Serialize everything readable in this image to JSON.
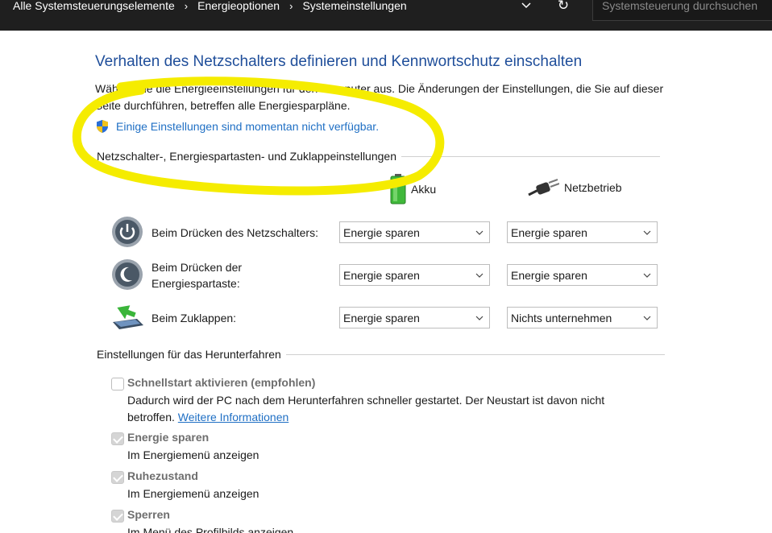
{
  "breadcrumb": {
    "items": [
      "Alle Systemsteuerungselemente",
      "Energieoptionen",
      "Systemeinstellungen"
    ]
  },
  "search": {
    "placeholder": "Systemsteuerung durchsuchen"
  },
  "page": {
    "title": "Verhalten des Netzschalters definieren und Kennwortschutz einschalten",
    "intro": "Wählen Sie die Energieeinstellungen für den Computer aus. Die Änderungen der Einstellungen, die Sie auf dieser Seite durchführen, betreffen alle Energiesparpläne.",
    "unavailable_link": "Einige Einstellungen sind momentan nicht verfügbar."
  },
  "buttons_section": {
    "heading": "Netzschalter-, Energiespartasten- und Zuklappeinstellungen",
    "col_battery": "Akku",
    "col_power": "Netzbetrieb",
    "rows": [
      {
        "label": "Beim Drücken des Netzschalters:",
        "battery": "Energie sparen",
        "power": "Energie sparen"
      },
      {
        "label": "Beim Drücken der Energiespartaste:",
        "battery": "Energie sparen",
        "power": "Energie sparen"
      },
      {
        "label": "Beim Zuklappen:",
        "battery": "Energie sparen",
        "power": "Nichts unternehmen"
      }
    ]
  },
  "shutdown_section": {
    "heading": "Einstellungen für das Herunterfahren",
    "options": [
      {
        "title": "Schnellstart aktivieren (empfohlen)",
        "checked": false,
        "desc": "Dadurch wird der PC nach dem Herunterfahren schneller gestartet. Der Neustart ist davon nicht betroffen.",
        "link": "Weitere Informationen"
      },
      {
        "title": "Energie sparen",
        "checked": true,
        "desc": "Im Energiemenü anzeigen"
      },
      {
        "title": "Ruhezustand",
        "checked": true,
        "desc": "Im Energiemenü anzeigen"
      },
      {
        "title": "Sperren",
        "checked": true,
        "desc": "Im Menü des Profilbilds anzeigen"
      }
    ]
  },
  "colors": {
    "title": "#1f4e9a",
    "link": "#1f6fc4",
    "topbar": "#1f1f1f",
    "annotation": "#f5ec00"
  }
}
